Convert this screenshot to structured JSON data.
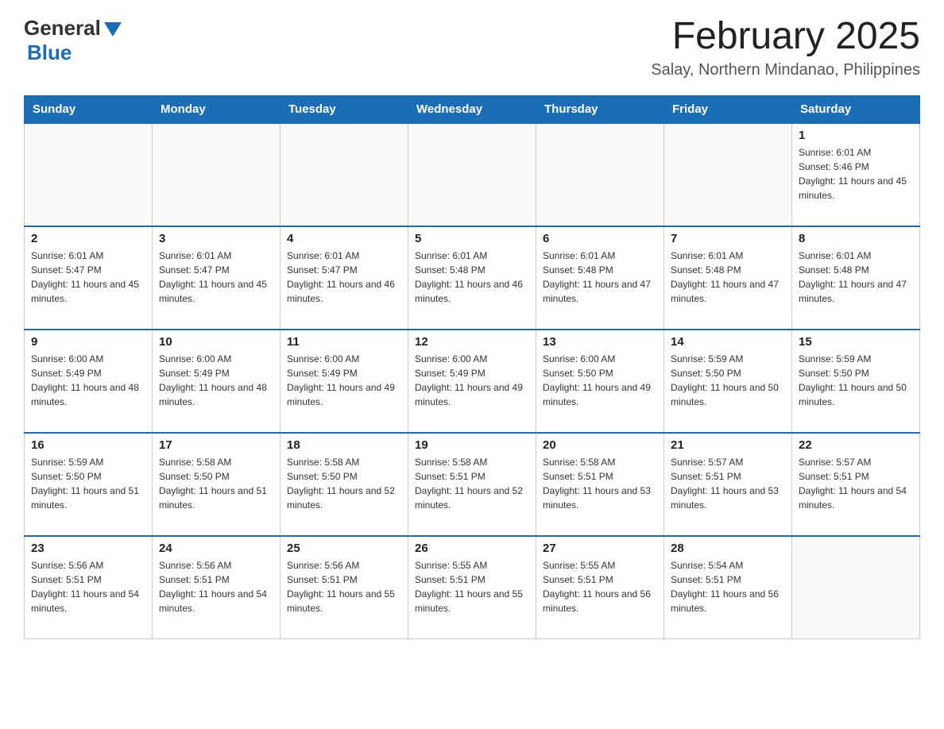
{
  "header": {
    "logo_general": "General",
    "logo_blue": "Blue",
    "month_title": "February 2025",
    "location": "Salay, Northern Mindanao, Philippines"
  },
  "days_of_week": [
    "Sunday",
    "Monday",
    "Tuesday",
    "Wednesday",
    "Thursday",
    "Friday",
    "Saturday"
  ],
  "weeks": [
    [
      {
        "day": "",
        "info": ""
      },
      {
        "day": "",
        "info": ""
      },
      {
        "day": "",
        "info": ""
      },
      {
        "day": "",
        "info": ""
      },
      {
        "day": "",
        "info": ""
      },
      {
        "day": "",
        "info": ""
      },
      {
        "day": "1",
        "info": "Sunrise: 6:01 AM\nSunset: 5:46 PM\nDaylight: 11 hours and 45 minutes."
      }
    ],
    [
      {
        "day": "2",
        "info": "Sunrise: 6:01 AM\nSunset: 5:47 PM\nDaylight: 11 hours and 45 minutes."
      },
      {
        "day": "3",
        "info": "Sunrise: 6:01 AM\nSunset: 5:47 PM\nDaylight: 11 hours and 45 minutes."
      },
      {
        "day": "4",
        "info": "Sunrise: 6:01 AM\nSunset: 5:47 PM\nDaylight: 11 hours and 46 minutes."
      },
      {
        "day": "5",
        "info": "Sunrise: 6:01 AM\nSunset: 5:48 PM\nDaylight: 11 hours and 46 minutes."
      },
      {
        "day": "6",
        "info": "Sunrise: 6:01 AM\nSunset: 5:48 PM\nDaylight: 11 hours and 47 minutes."
      },
      {
        "day": "7",
        "info": "Sunrise: 6:01 AM\nSunset: 5:48 PM\nDaylight: 11 hours and 47 minutes."
      },
      {
        "day": "8",
        "info": "Sunrise: 6:01 AM\nSunset: 5:48 PM\nDaylight: 11 hours and 47 minutes."
      }
    ],
    [
      {
        "day": "9",
        "info": "Sunrise: 6:00 AM\nSunset: 5:49 PM\nDaylight: 11 hours and 48 minutes."
      },
      {
        "day": "10",
        "info": "Sunrise: 6:00 AM\nSunset: 5:49 PM\nDaylight: 11 hours and 48 minutes."
      },
      {
        "day": "11",
        "info": "Sunrise: 6:00 AM\nSunset: 5:49 PM\nDaylight: 11 hours and 49 minutes."
      },
      {
        "day": "12",
        "info": "Sunrise: 6:00 AM\nSunset: 5:49 PM\nDaylight: 11 hours and 49 minutes."
      },
      {
        "day": "13",
        "info": "Sunrise: 6:00 AM\nSunset: 5:50 PM\nDaylight: 11 hours and 49 minutes."
      },
      {
        "day": "14",
        "info": "Sunrise: 5:59 AM\nSunset: 5:50 PM\nDaylight: 11 hours and 50 minutes."
      },
      {
        "day": "15",
        "info": "Sunrise: 5:59 AM\nSunset: 5:50 PM\nDaylight: 11 hours and 50 minutes."
      }
    ],
    [
      {
        "day": "16",
        "info": "Sunrise: 5:59 AM\nSunset: 5:50 PM\nDaylight: 11 hours and 51 minutes."
      },
      {
        "day": "17",
        "info": "Sunrise: 5:58 AM\nSunset: 5:50 PM\nDaylight: 11 hours and 51 minutes."
      },
      {
        "day": "18",
        "info": "Sunrise: 5:58 AM\nSunset: 5:50 PM\nDaylight: 11 hours and 52 minutes."
      },
      {
        "day": "19",
        "info": "Sunrise: 5:58 AM\nSunset: 5:51 PM\nDaylight: 11 hours and 52 minutes."
      },
      {
        "day": "20",
        "info": "Sunrise: 5:58 AM\nSunset: 5:51 PM\nDaylight: 11 hours and 53 minutes."
      },
      {
        "day": "21",
        "info": "Sunrise: 5:57 AM\nSunset: 5:51 PM\nDaylight: 11 hours and 53 minutes."
      },
      {
        "day": "22",
        "info": "Sunrise: 5:57 AM\nSunset: 5:51 PM\nDaylight: 11 hours and 54 minutes."
      }
    ],
    [
      {
        "day": "23",
        "info": "Sunrise: 5:56 AM\nSunset: 5:51 PM\nDaylight: 11 hours and 54 minutes."
      },
      {
        "day": "24",
        "info": "Sunrise: 5:56 AM\nSunset: 5:51 PM\nDaylight: 11 hours and 54 minutes."
      },
      {
        "day": "25",
        "info": "Sunrise: 5:56 AM\nSunset: 5:51 PM\nDaylight: 11 hours and 55 minutes."
      },
      {
        "day": "26",
        "info": "Sunrise: 5:55 AM\nSunset: 5:51 PM\nDaylight: 11 hours and 55 minutes."
      },
      {
        "day": "27",
        "info": "Sunrise: 5:55 AM\nSunset: 5:51 PM\nDaylight: 11 hours and 56 minutes."
      },
      {
        "day": "28",
        "info": "Sunrise: 5:54 AM\nSunset: 5:51 PM\nDaylight: 11 hours and 56 minutes."
      },
      {
        "day": "",
        "info": ""
      }
    ]
  ]
}
